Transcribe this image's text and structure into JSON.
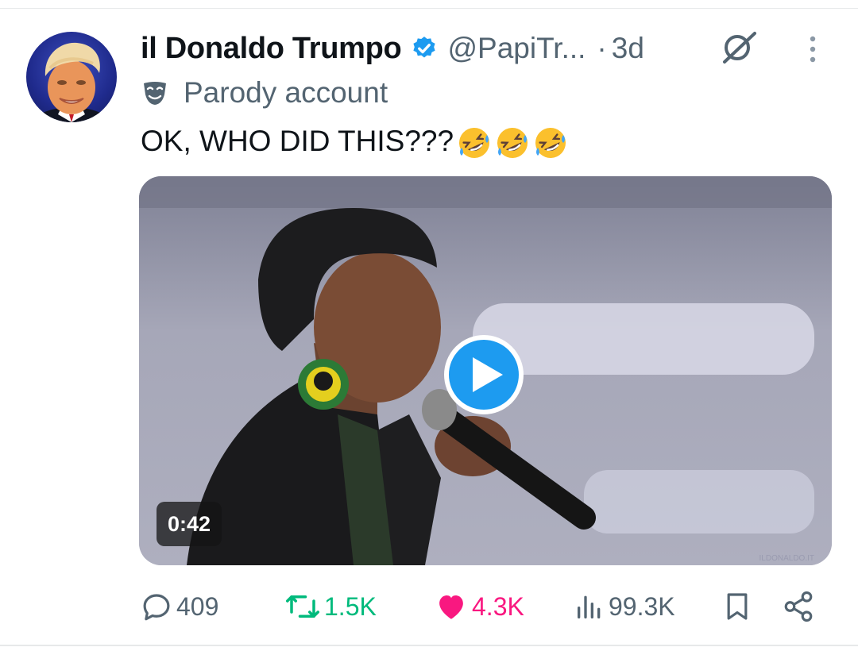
{
  "tweet": {
    "author": {
      "display_name": "il Donaldo Trumpo",
      "handle": "@PapiTr...",
      "verified": true,
      "label": "Parody account",
      "avatar_icon": "profile-photo"
    },
    "separator": "·",
    "time": "3d",
    "text": "OK, WHO DID THIS???",
    "emoji": [
      "rolling-on-floor-laughing",
      "rolling-on-floor-laughing",
      "rolling-on-floor-laughing"
    ],
    "media": {
      "type": "video",
      "duration": "0:42",
      "play_icon": "play-icon",
      "watermark": "ILDONALDO.IT"
    }
  },
  "actions": {
    "reply": {
      "icon": "reply-icon",
      "count": "409"
    },
    "retweet": {
      "icon": "retweet-icon",
      "count": "1.5K",
      "color": "#00ba7c"
    },
    "like": {
      "icon": "heart-icon",
      "count": "4.3K",
      "color": "#f91880",
      "liked": true
    },
    "views": {
      "icon": "views-icon",
      "count": "99.3K"
    },
    "bookmark": {
      "icon": "bookmark-icon"
    },
    "share": {
      "icon": "share-icon"
    }
  },
  "colors": {
    "accent": "#1d9bf0",
    "secondary_text": "#536471",
    "primary_text": "#0f1419"
  }
}
